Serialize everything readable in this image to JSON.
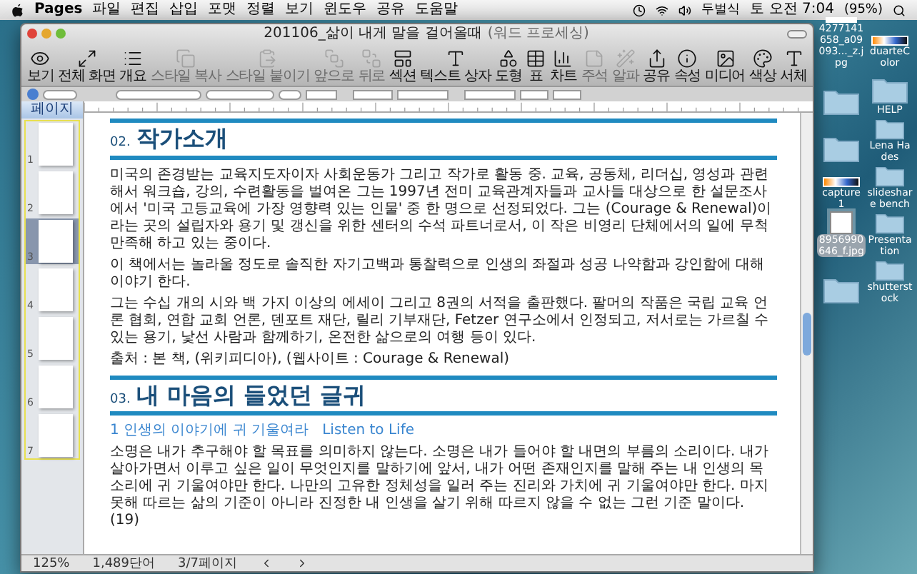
{
  "menubar": {
    "app": "Pages",
    "menus": [
      "파일",
      "편집",
      "삽입",
      "포맷",
      "정렬",
      "보기",
      "윈도우",
      "공유",
      "도움말"
    ],
    "input_method": "두벌식",
    "clock": "토 오전 7:04",
    "battery": "(95%)"
  },
  "window": {
    "title": "201106_삶이 내게 말을 걸어올때",
    "title_suffix": "(워드 프로세싱)"
  },
  "toolbar": [
    {
      "label": "보기",
      "disabled": false
    },
    {
      "label": "전체 화면",
      "disabled": false
    },
    {
      "label": "개요",
      "disabled": false
    },
    {
      "label": "스타일 복사",
      "disabled": true
    },
    {
      "label": "스타일 붙이기",
      "disabled": true
    },
    {
      "label": "앞으로",
      "disabled": true
    },
    {
      "label": "뒤로",
      "disabled": true
    },
    {
      "label": "섹션",
      "disabled": false
    },
    {
      "label": "텍스트 상자",
      "disabled": false
    },
    {
      "label": "도형",
      "disabled": false
    },
    {
      "label": "표",
      "disabled": false
    },
    {
      "label": "차트",
      "disabled": false
    },
    {
      "label": "주석",
      "disabled": true
    },
    {
      "label": "알파",
      "disabled": true
    },
    {
      "label": "공유",
      "disabled": false
    },
    {
      "label": "속성",
      "disabled": false
    },
    {
      "label": "미디어",
      "disabled": false
    },
    {
      "label": "색상",
      "disabled": false
    },
    {
      "label": "서체",
      "disabled": false
    }
  ],
  "sidebar": {
    "title": "페이지",
    "pages": [
      {
        "number": "1",
        "selected": false
      },
      {
        "number": "2",
        "selected": false
      },
      {
        "number": "3",
        "selected": true
      },
      {
        "number": "4",
        "selected": false
      },
      {
        "number": "5",
        "selected": false
      },
      {
        "number": "6",
        "selected": false
      },
      {
        "number": "7",
        "selected": false
      }
    ]
  },
  "document": [
    {
      "kind": "heading",
      "number": "02.",
      "text": "작가소개"
    },
    {
      "kind": "paragraph",
      "text": "미국의 존경받는 교육지도자이자 사회운동가 그리고 작가로 활동 중. 교육, 공동체, 리더십, 영성과 관련해서 워크숍, 강의, 수련활동을 벌여온 그는 1997년 전미 교육관계자들과 교사들 대상으로 한 설문조사에서 '미국 고등교육에 가장 영향력 있는 인물' 중 한 명으로 선정되었다. 그는 (Courage & Renewal)이라는 곳의 설립자와 용기 및 갱신을 위한 센터의 수석 파트너로서, 이 작은 비영리 단체에서의 일에 무척 만족해 하고 있는 중이다."
    },
    {
      "kind": "paragraph",
      "text": "이 책에서는 놀라울 정도로 솔직한 자기고백과 통찰력으로 인생의 좌절과 성공 나약함과 강인함에 대해 이야기 한다."
    },
    {
      "kind": "paragraph",
      "text": "그는 수십 개의 시와 백 가지 이상의 에세이 그리고 8권의 서적을 출판했다. 팔머의 작품은 국립 교육 언론 협회, 연합 교회 언론, 덴포트 재단, 릴리 기부재단, Fetzer 연구소에서 인정되고, 저서로는 가르칠 수 있는 용기, 낯선 사람과 함께하기, 온전한 삶으로의 여행 등이 있다."
    },
    {
      "kind": "paragraph",
      "text": "출처 : 본 책, (위키피디아), (웹사이트 : Courage & Renewal)"
    },
    {
      "kind": "heading",
      "number": "03.",
      "text": "내 마음의 들었던 글귀"
    },
    {
      "kind": "subheading",
      "text": "1 인생의 이야기에 귀 기울여라   Listen to Life"
    },
    {
      "kind": "paragraph",
      "text": "소명은 내가 추구해야 할 목표를 의미하지 않는다. 소명은 내가 들어야 할 내면의 부름의 소리이다. 내가 살아가면서 이루고 싶은 일이 무엇인지를 말하기에 앞서, 내가 어떤 존재인지를 말해 주는 내 인생의 목소리에 귀 기울여야만 한다. 나만의 고유한 정체성을 일러 주는 진리와 가치에 귀 기울여야만 한다. 마지못해 따르는 삶의 기준이 아니라 진정한 내 인생을 살기 위해 따르지 않을 수 없는 그런 기준 말이다. (19)"
    }
  ],
  "status_bar": {
    "zoom": "125%",
    "words": "1,489단어",
    "pages": "3/7페이지"
  },
  "desktop_icons": [
    {
      "kind": "photo",
      "label": "4277141658_a09093..._z.jpg",
      "selected": false
    },
    {
      "kind": "strip",
      "label": "duarteColor",
      "selected": false
    },
    {
      "kind": "folder",
      "selected": false
    },
    {
      "kind": "folder",
      "label": "HELP",
      "selected": false
    },
    {
      "kind": "folder",
      "selected": false
    },
    {
      "kind": "folder",
      "label": "Lena Hades",
      "selected": false
    },
    {
      "kind": "strip",
      "label": "capture 1",
      "selected": false
    },
    {
      "kind": "folder",
      "label": "slideshare bench",
      "selected": false
    },
    {
      "kind": "document",
      "label": "8956990646_f.jpg",
      "selected": true
    },
    {
      "kind": "folder",
      "label": "Presentation",
      "selected": false
    },
    {
      "kind": "folder",
      "selected": false
    },
    {
      "kind": "folder",
      "label": "shutterstock",
      "selected": false
    }
  ]
}
